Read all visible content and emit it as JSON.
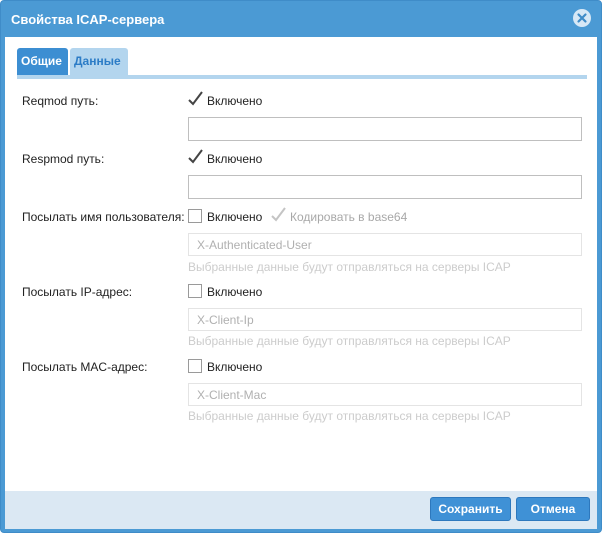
{
  "dialog": {
    "title": "Свойства ICAP-сервера"
  },
  "tabs": [
    {
      "label": "Общие",
      "active": false
    },
    {
      "label": "Данные",
      "active": true
    }
  ],
  "form": {
    "reqmod": {
      "label": "Reqmod путь:",
      "checkbox_label": "Включено",
      "checked": true,
      "value": ""
    },
    "respmod": {
      "label": "Respmod путь:",
      "checkbox_label": "Включено",
      "checked": true,
      "value": ""
    },
    "send_user": {
      "label": "Посылать имя пользователя:",
      "checkbox_label": "Включено",
      "checked": false,
      "base64_label": "Кодировать в base64",
      "base64_checked": true,
      "base64_disabled": true,
      "value": "X-Authenticated-User",
      "hint": "Выбранные данные будут отправляться на серверы ICAP"
    },
    "send_ip": {
      "label": "Посылать IP-адрес:",
      "checkbox_label": "Включено",
      "checked": false,
      "value": "X-Client-Ip",
      "hint": "Выбранные данные будут отправляться на серверы ICAP"
    },
    "send_mac": {
      "label": "Посылать MAC-адрес:",
      "checkbox_label": "Включено",
      "checked": false,
      "value": "X-Client-Mac",
      "hint": "Выбранные данные будут отправляться на серверы ICAP"
    }
  },
  "footer": {
    "save_label": "Сохранить",
    "cancel_label": "Отмена"
  },
  "colors": {
    "frame": "#4b9ad4",
    "active_tab": "#3c8ed2",
    "inactive_tab": "#b3d5ee",
    "button": "#3f91d6",
    "footer": "#dbe8f3"
  },
  "icons": {
    "close": "close-icon",
    "check": "checkmark-icon"
  }
}
